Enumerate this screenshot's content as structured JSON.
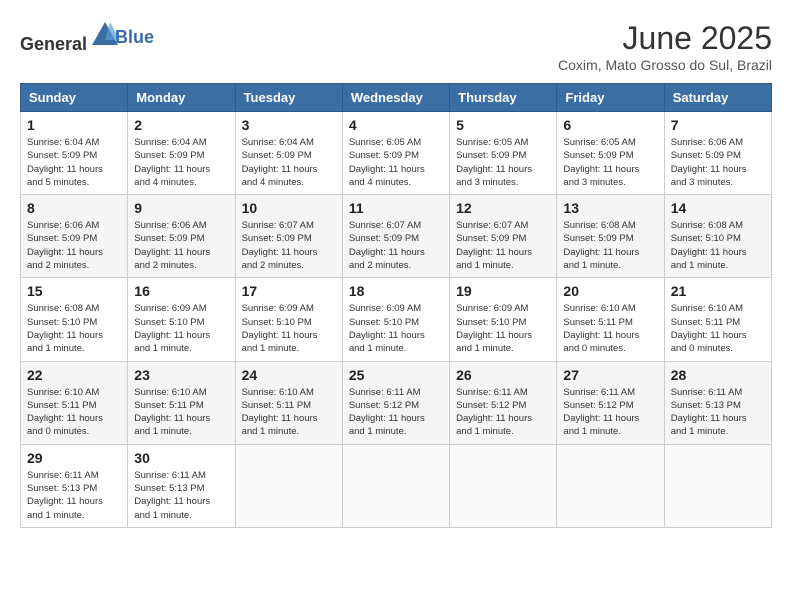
{
  "header": {
    "logo_general": "General",
    "logo_blue": "Blue",
    "month": "June 2025",
    "location": "Coxim, Mato Grosso do Sul, Brazil"
  },
  "days_of_week": [
    "Sunday",
    "Monday",
    "Tuesday",
    "Wednesday",
    "Thursday",
    "Friday",
    "Saturday"
  ],
  "weeks": [
    [
      {
        "day": 1,
        "sunrise": "6:04 AM",
        "sunset": "5:09 PM",
        "daylight": "11 hours and 5 minutes."
      },
      {
        "day": 2,
        "sunrise": "6:04 AM",
        "sunset": "5:09 PM",
        "daylight": "11 hours and 4 minutes."
      },
      {
        "day": 3,
        "sunrise": "6:04 AM",
        "sunset": "5:09 PM",
        "daylight": "11 hours and 4 minutes."
      },
      {
        "day": 4,
        "sunrise": "6:05 AM",
        "sunset": "5:09 PM",
        "daylight": "11 hours and 4 minutes."
      },
      {
        "day": 5,
        "sunrise": "6:05 AM",
        "sunset": "5:09 PM",
        "daylight": "11 hours and 3 minutes."
      },
      {
        "day": 6,
        "sunrise": "6:05 AM",
        "sunset": "5:09 PM",
        "daylight": "11 hours and 3 minutes."
      },
      {
        "day": 7,
        "sunrise": "6:06 AM",
        "sunset": "5:09 PM",
        "daylight": "11 hours and 3 minutes."
      }
    ],
    [
      {
        "day": 8,
        "sunrise": "6:06 AM",
        "sunset": "5:09 PM",
        "daylight": "11 hours and 2 minutes."
      },
      {
        "day": 9,
        "sunrise": "6:06 AM",
        "sunset": "5:09 PM",
        "daylight": "11 hours and 2 minutes."
      },
      {
        "day": 10,
        "sunrise": "6:07 AM",
        "sunset": "5:09 PM",
        "daylight": "11 hours and 2 minutes."
      },
      {
        "day": 11,
        "sunrise": "6:07 AM",
        "sunset": "5:09 PM",
        "daylight": "11 hours and 2 minutes."
      },
      {
        "day": 12,
        "sunrise": "6:07 AM",
        "sunset": "5:09 PM",
        "daylight": "11 hours and 1 minute."
      },
      {
        "day": 13,
        "sunrise": "6:08 AM",
        "sunset": "5:09 PM",
        "daylight": "11 hours and 1 minute."
      },
      {
        "day": 14,
        "sunrise": "6:08 AM",
        "sunset": "5:10 PM",
        "daylight": "11 hours and 1 minute."
      }
    ],
    [
      {
        "day": 15,
        "sunrise": "6:08 AM",
        "sunset": "5:10 PM",
        "daylight": "11 hours and 1 minute."
      },
      {
        "day": 16,
        "sunrise": "6:09 AM",
        "sunset": "5:10 PM",
        "daylight": "11 hours and 1 minute."
      },
      {
        "day": 17,
        "sunrise": "6:09 AM",
        "sunset": "5:10 PM",
        "daylight": "11 hours and 1 minute."
      },
      {
        "day": 18,
        "sunrise": "6:09 AM",
        "sunset": "5:10 PM",
        "daylight": "11 hours and 1 minute."
      },
      {
        "day": 19,
        "sunrise": "6:09 AM",
        "sunset": "5:10 PM",
        "daylight": "11 hours and 1 minute."
      },
      {
        "day": 20,
        "sunrise": "6:10 AM",
        "sunset": "5:11 PM",
        "daylight": "11 hours and 0 minutes."
      },
      {
        "day": 21,
        "sunrise": "6:10 AM",
        "sunset": "5:11 PM",
        "daylight": "11 hours and 0 minutes."
      }
    ],
    [
      {
        "day": 22,
        "sunrise": "6:10 AM",
        "sunset": "5:11 PM",
        "daylight": "11 hours and 0 minutes."
      },
      {
        "day": 23,
        "sunrise": "6:10 AM",
        "sunset": "5:11 PM",
        "daylight": "11 hours and 1 minute."
      },
      {
        "day": 24,
        "sunrise": "6:10 AM",
        "sunset": "5:11 PM",
        "daylight": "11 hours and 1 minute."
      },
      {
        "day": 25,
        "sunrise": "6:11 AM",
        "sunset": "5:12 PM",
        "daylight": "11 hours and 1 minute."
      },
      {
        "day": 26,
        "sunrise": "6:11 AM",
        "sunset": "5:12 PM",
        "daylight": "11 hours and 1 minute."
      },
      {
        "day": 27,
        "sunrise": "6:11 AM",
        "sunset": "5:12 PM",
        "daylight": "11 hours and 1 minute."
      },
      {
        "day": 28,
        "sunrise": "6:11 AM",
        "sunset": "5:13 PM",
        "daylight": "11 hours and 1 minute."
      }
    ],
    [
      {
        "day": 29,
        "sunrise": "6:11 AM",
        "sunset": "5:13 PM",
        "daylight": "11 hours and 1 minute."
      },
      {
        "day": 30,
        "sunrise": "6:11 AM",
        "sunset": "5:13 PM",
        "daylight": "11 hours and 1 minute."
      },
      null,
      null,
      null,
      null,
      null
    ]
  ]
}
